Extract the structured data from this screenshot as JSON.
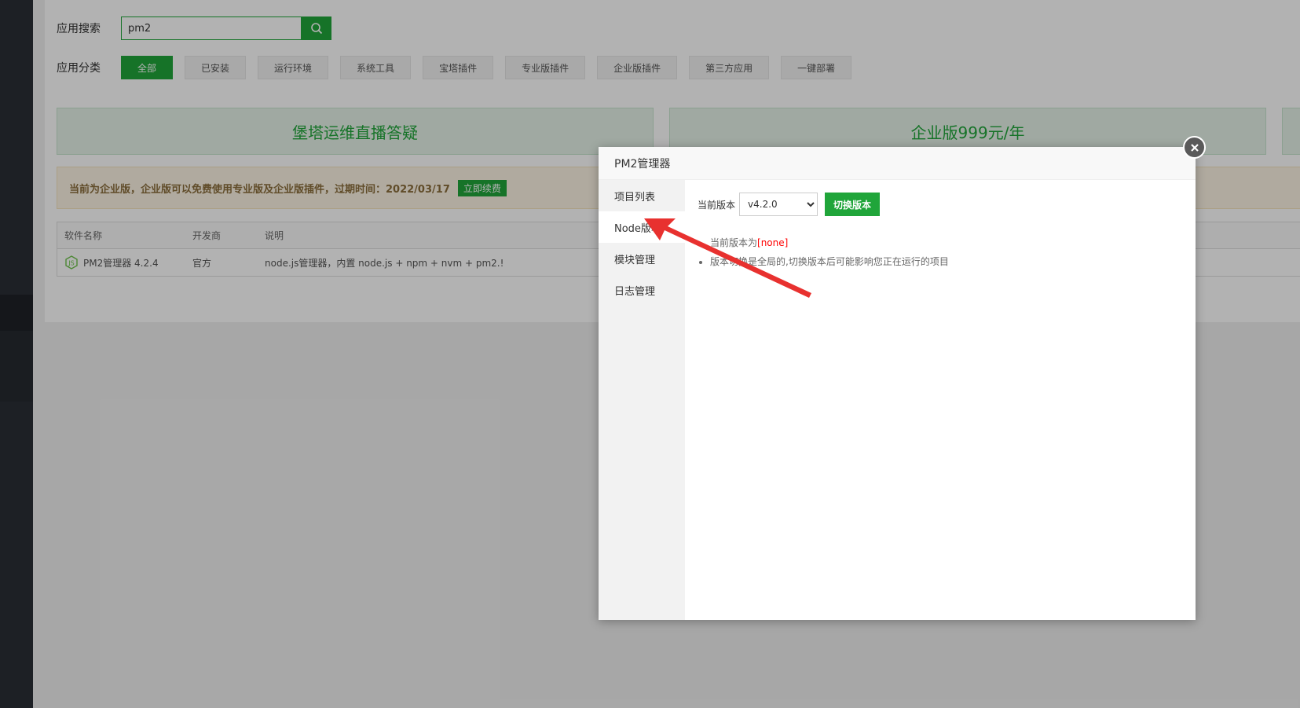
{
  "search": {
    "label": "应用搜索",
    "value": "pm2"
  },
  "category": {
    "label": "应用分类",
    "items": [
      "全部",
      "已安装",
      "运行环境",
      "系统工具",
      "宝塔插件",
      "专业版插件",
      "企业版插件",
      "第三方应用",
      "一键部署"
    ],
    "active": "全部"
  },
  "banners": [
    "堡塔运维直播答疑",
    "企业版999元/年"
  ],
  "notice": {
    "text": "当前为企业版，企业版可以免费使用专业版及企业版插件，过期时间：2022/03/17",
    "button": "立即续费"
  },
  "table": {
    "headers": [
      "软件名称",
      "开发商",
      "说明"
    ],
    "rows": [
      {
        "name": "PM2管理器 4.2.4",
        "developer": "官方",
        "description": "node.js管理器，内置 node.js + npm + nvm + pm2.!"
      }
    ]
  },
  "modal": {
    "title": "PM2管理器",
    "tabs": [
      "项目列表",
      "Node版本",
      "模块管理",
      "日志管理"
    ],
    "active_tab": "Node版本",
    "version_label": "当前版本",
    "version_value": "v4.2.0",
    "switch_button": "切换版本",
    "current_prefix": "当前版本为",
    "current_value": "[none]",
    "tip": "版本切换是全局的,切换版本后可能影响您正在运行的项目"
  },
  "colors": {
    "accent": "#20a53a",
    "sidebar": "#2a2e35",
    "arrow": "#e8312f"
  }
}
